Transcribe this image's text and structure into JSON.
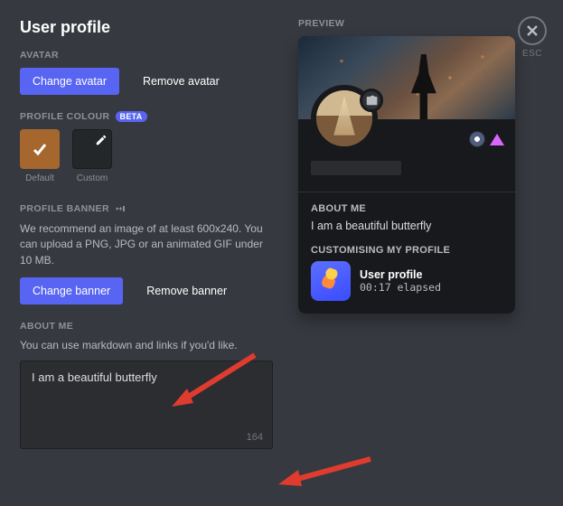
{
  "title": "User profile",
  "close": {
    "esc_label": "ESC"
  },
  "avatar": {
    "label": "AVATAR",
    "change_label": "Change avatar",
    "remove_label": "Remove avatar"
  },
  "colour": {
    "label": "PROFILE COLOUR",
    "badge": "BETA",
    "default_label": "Default",
    "custom_label": "Custom",
    "default_hex": "#a6672f"
  },
  "banner": {
    "label": "PROFILE BANNER",
    "desc": "We recommend an image of at least 600x240. You can upload a PNG, JPG or an animated GIF under 10 MB.",
    "change_label": "Change banner",
    "remove_label": "Remove banner"
  },
  "about": {
    "label": "ABOUT ME",
    "desc": "You can use markdown and links if you'd like.",
    "value": "I am a beautiful butterfly",
    "char_remaining": "164"
  },
  "preview": {
    "label": "PREVIEW",
    "about_heading": "ABOUT ME",
    "about_text": "I am a beautiful butterfly",
    "activity_heading": "CUSTOMISING MY PROFILE",
    "activity_title": "User profile",
    "activity_elapsed": "00:17 elapsed"
  }
}
